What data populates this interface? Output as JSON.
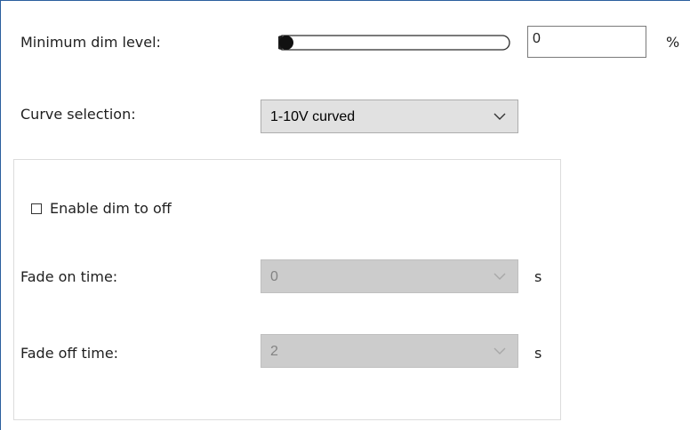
{
  "settings": {
    "min_dim": {
      "label": "Minimum dim level:",
      "value": "0",
      "unit": "%",
      "slider_level": 0
    },
    "curve": {
      "label": "Curve selection:",
      "selected": "1-10V curved"
    },
    "dim_to_off": {
      "label": "Enable dim to off",
      "checked": false
    },
    "fade_on": {
      "label": "Fade on time:",
      "selected": "0",
      "unit": "s"
    },
    "fade_off": {
      "label": "Fade off time:",
      "selected": "2",
      "unit": "s"
    }
  },
  "colors": {
    "window_accent": "#2b5f9e",
    "combo_enabled_bg": "#e1e1e1",
    "combo_disabled_bg": "#cccccc",
    "disabled_text": "#838383"
  }
}
